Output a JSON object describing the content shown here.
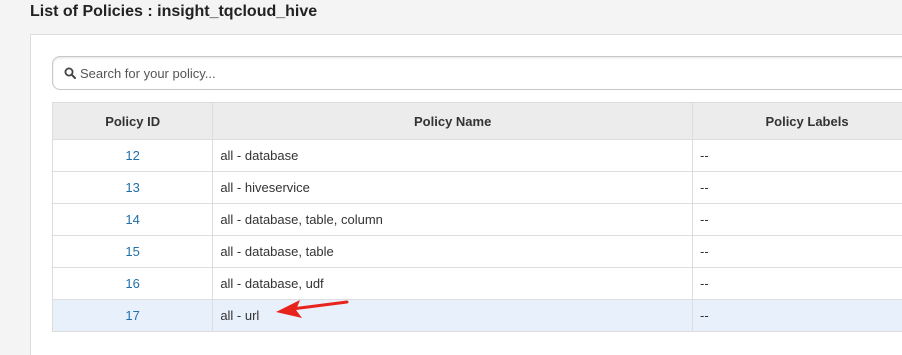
{
  "page": {
    "title": "List of Policies : insight_tqcloud_hive"
  },
  "search": {
    "placeholder": "Search for your policy...",
    "value": ""
  },
  "table": {
    "columns": [
      "Policy ID",
      "Policy Name",
      "Policy Labels"
    ],
    "rows": [
      {
        "id": "12",
        "name": "all - database",
        "labels": "--"
      },
      {
        "id": "13",
        "name": "all - hiveservice",
        "labels": "--"
      },
      {
        "id": "14",
        "name": "all - database, table, column",
        "labels": "--"
      },
      {
        "id": "15",
        "name": "all - database, table",
        "labels": "--"
      },
      {
        "id": "16",
        "name": "all - database, udf",
        "labels": "--"
      },
      {
        "id": "17",
        "name": "all - url",
        "labels": "--"
      }
    ]
  },
  "annotation": {
    "arrow_color": "#e8231b",
    "icon": "red-arrow-icon"
  },
  "colors": {
    "link": "#1f6fa9",
    "header_bg": "#ececec",
    "highlight_row": "#e8f0fb"
  }
}
